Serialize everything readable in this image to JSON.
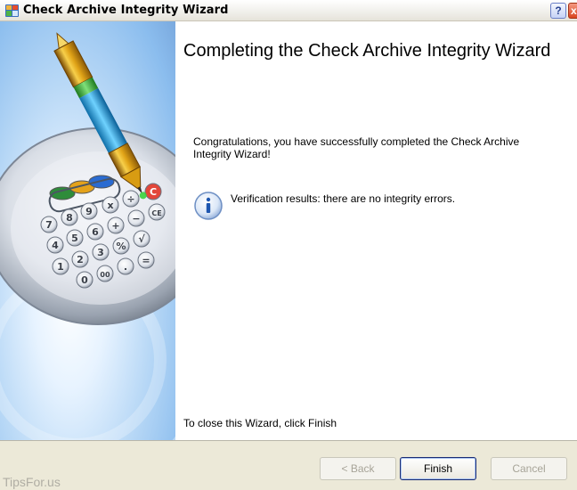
{
  "window": {
    "title": "Check Archive Integrity Wizard",
    "help_glyph": "?",
    "close_glyph": "x"
  },
  "page": {
    "heading": "Completing the Check Archive Integrity Wizard",
    "congrats": "Congratulations, you have successfully completed the Check Archive Integrity Wizard!",
    "verification": "Verification results: there are no integrity errors.",
    "close_hint": "To close this Wizard, click Finish"
  },
  "buttons": {
    "back": "< Back",
    "finish": "Finish",
    "cancel": "Cancel"
  },
  "watermark": "TipsFor.us",
  "icons": {
    "app": "archive-wizard-icon",
    "info": "info-icon",
    "art": "calculator-pen-illustration"
  },
  "calculator_keys": [
    "7",
    "8",
    "9",
    "x",
    "÷",
    "C",
    "4",
    "5",
    "6",
    "+",
    "−",
    "CE",
    "1",
    "2",
    "3",
    "%",
    "√",
    "0",
    "00",
    ".",
    "="
  ],
  "colors": {
    "accent_blue": "#7aa9de",
    "finish_border": "#1b2c73",
    "disabled_text": "#a7a498",
    "footer_bg": "#ece9d8"
  }
}
